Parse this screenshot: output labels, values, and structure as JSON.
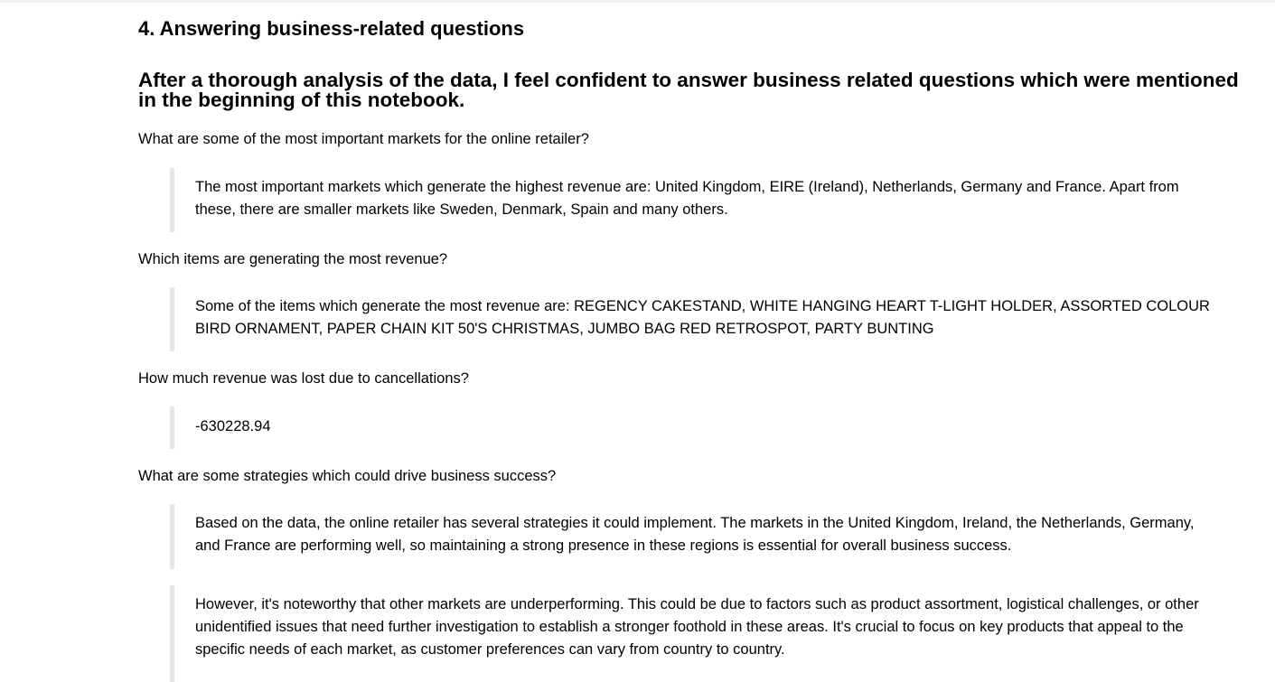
{
  "section_heading": "4. Answering business-related questions",
  "intro_heading": "After a thorough analysis of the data, I feel confident to answer business related questions which were mentioned in the beginning of this notebook.",
  "qa": [
    {
      "question": "What are some of the most important markets for the online retailer?",
      "answers": [
        "The most important markets which generate the highest revenue are: United Kingdom, EIRE (Ireland), Netherlands, Germany and France. Apart from these, there are smaller markets like Sweden, Denmark, Spain and many others."
      ]
    },
    {
      "question": "Which items are generating the most revenue?",
      "answers": [
        "Some of the items which generate the most revenue are: REGENCY CAKESTAND, WHITE HANGING HEART T-LIGHT HOLDER, ASSORTED COLOUR BIRD ORNAMENT, PAPER CHAIN KIT 50'S CHRISTMAS, JUMBO BAG RED RETROSPOT, PARTY BUNTING"
      ]
    },
    {
      "question": "How much revenue was lost due to cancellations?",
      "answers": [
        "-630228.94"
      ]
    },
    {
      "question": "What are some strategies which could drive business success?",
      "answers": [
        "Based on the data, the online retailer has several strategies it could implement. The markets in the United Kingdom, Ireland, the Netherlands, Germany, and France are performing well, so maintaining a strong presence in these regions is essential for overall business success.",
        "However, it's noteworthy that other markets are underperforming. This could be due to factors such as product assortment, logistical challenges, or other unidentified issues that need further investigation to establish a stronger foothold in these areas. It's crucial to focus on key products that appeal to the specific needs of each market, as customer preferences can vary from country to country."
      ]
    }
  ]
}
